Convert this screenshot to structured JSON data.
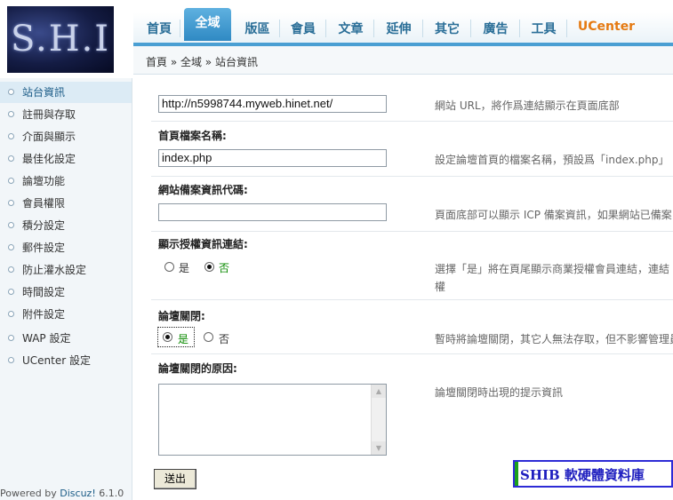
{
  "logo": {
    "text": "S.H.I"
  },
  "topnav": {
    "tabs": [
      "首頁",
      "全域",
      "版區",
      "會員",
      "文章",
      "延伸",
      "其它",
      "廣告",
      "工具",
      "UCenter"
    ]
  },
  "breadcrumb": "首頁 » 全域 » 站台資訊",
  "sidebar": {
    "items": [
      "站台資訊",
      "註冊與存取",
      "介面與顯示",
      "最佳化設定",
      "論壇功能",
      "會員權限",
      "積分設定",
      "郵件設定",
      "防止灌水設定",
      "時間設定",
      "附件設定",
      "WAP 設定",
      "UCenter 設定"
    ]
  },
  "powered": {
    "prefix": "Powered by ",
    "brand": "Discuz!",
    "version": " 6.1.0"
  },
  "form": {
    "site_url_value": "http://n5998744.myweb.hinet.net/",
    "site_url_tip": "網站 URL，將作爲連結顯示在頁面底部",
    "index_label": "首頁檔案名稱:",
    "index_value": "index.php",
    "index_tip": "設定論壇首頁的檔案名稱，預設爲「index.php」",
    "icp_label": "網站備案資訊代碼:",
    "icp_value": "",
    "icp_tip": "頁面底部可以顯示 ICP 備案資訊，如果網站已備案",
    "license_label": "顯示授權資訊連結:",
    "license_yes": "是",
    "license_no": "否",
    "license_tip_1": "選擇「是」將在頁尾顯示商業授權會員連結，連結",
    "license_tip_2": "權",
    "closed_label": "論壇關閉:",
    "closed_yes": "是",
    "closed_no": "否",
    "closed_tip": "暫時將論壇關閉，其它人無法存取，但不影響管理員",
    "reason_label": "論壇關閉的原因:",
    "reason_value": "",
    "reason_tip": "論壇關閉時出現的提示資訊",
    "submit_label": "送出"
  },
  "watermark": "SHIB 軟硬體資料庫"
}
